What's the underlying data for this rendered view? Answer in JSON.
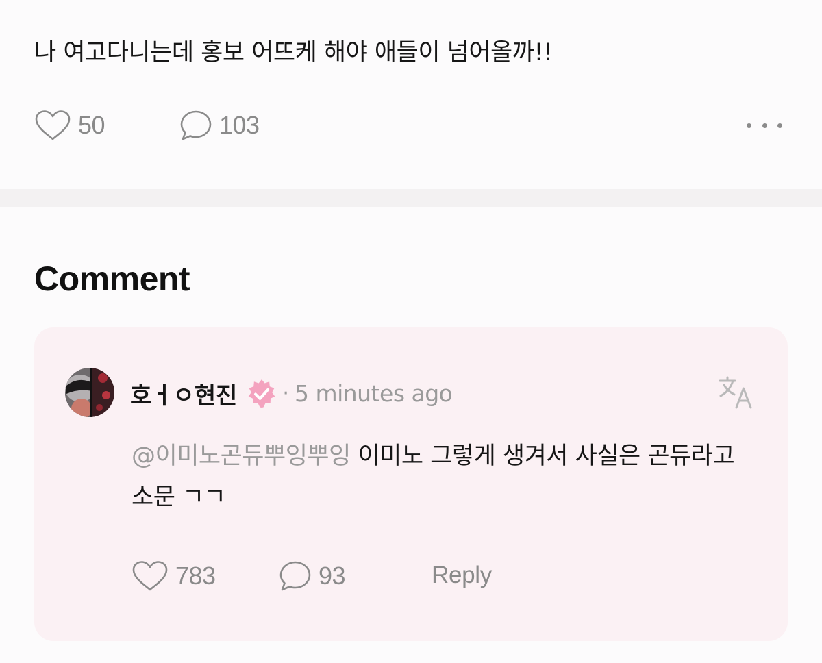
{
  "post": {
    "text": "나 여고다니는데 홍보 어뜨케 해야 애들이 넘어올까!!",
    "likes": "50",
    "comments": "103",
    "icons": {
      "like": "heart-icon",
      "comment": "speech-bubble-icon",
      "more": "more-dots-icon"
    }
  },
  "comment_section": {
    "heading": "Comment",
    "comment": {
      "author": "호ㅓㅇ현진",
      "verified_icon": "verified-badge-icon",
      "verified_color": "#f4a3bf",
      "separator": "·",
      "timestamp": "5 minutes ago",
      "translate_icon": "translate-icon",
      "mention": "@이미노곤듀뿌잉뿌잉",
      "text": " 이미노 그렇게 생겨서 사실은 곤듀라고 소문 ㄱㄱ",
      "likes": "783",
      "replies": "93",
      "reply_label": "Reply"
    }
  },
  "colors": {
    "background": "#fcfbfc",
    "card_background": "#fbf1f4",
    "divider": "#f3f1f2",
    "muted_text": "#8a8a8a"
  }
}
